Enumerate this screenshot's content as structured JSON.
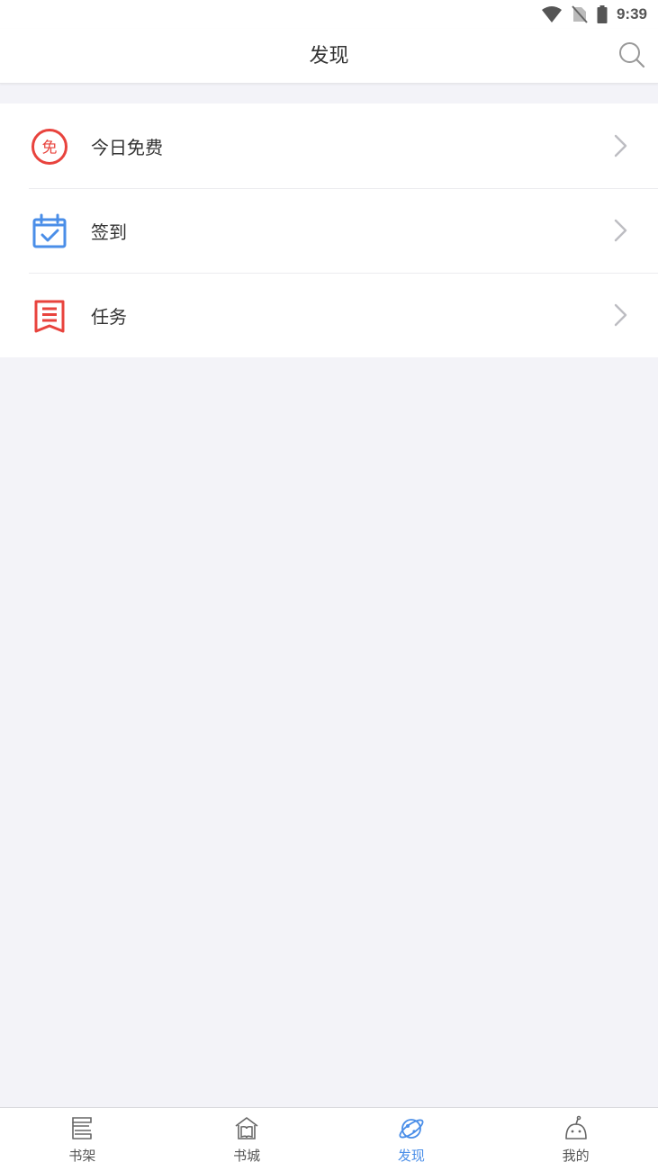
{
  "status_bar": {
    "time": "9:39",
    "icons": [
      "wifi-icon",
      "no-sim-icon",
      "battery-icon"
    ]
  },
  "header": {
    "title": "发现",
    "search_icon": "search-icon"
  },
  "menu": {
    "items": [
      {
        "label": "今日免费",
        "icon": "free-badge-icon",
        "icon_text": "免",
        "icon_color": "#e8433d"
      },
      {
        "label": "签到",
        "icon": "calendar-check-icon",
        "icon_color": "#4a8ee8"
      },
      {
        "label": "任务",
        "icon": "task-list-icon",
        "icon_color": "#e8433d"
      }
    ]
  },
  "tabbar": {
    "tabs": [
      {
        "label": "书架",
        "icon": "bookshelf-icon",
        "active": false
      },
      {
        "label": "书城",
        "icon": "bookstore-icon",
        "active": false
      },
      {
        "label": "发现",
        "icon": "planet-icon",
        "active": true
      },
      {
        "label": "我的",
        "icon": "profile-icon",
        "active": false
      }
    ],
    "active_color": "#4a8ee8",
    "inactive_color": "#555555"
  },
  "colors": {
    "background": "#f3f3f8",
    "surface": "#ffffff",
    "accent_blue": "#4a8ee8",
    "accent_red": "#e8433d"
  }
}
